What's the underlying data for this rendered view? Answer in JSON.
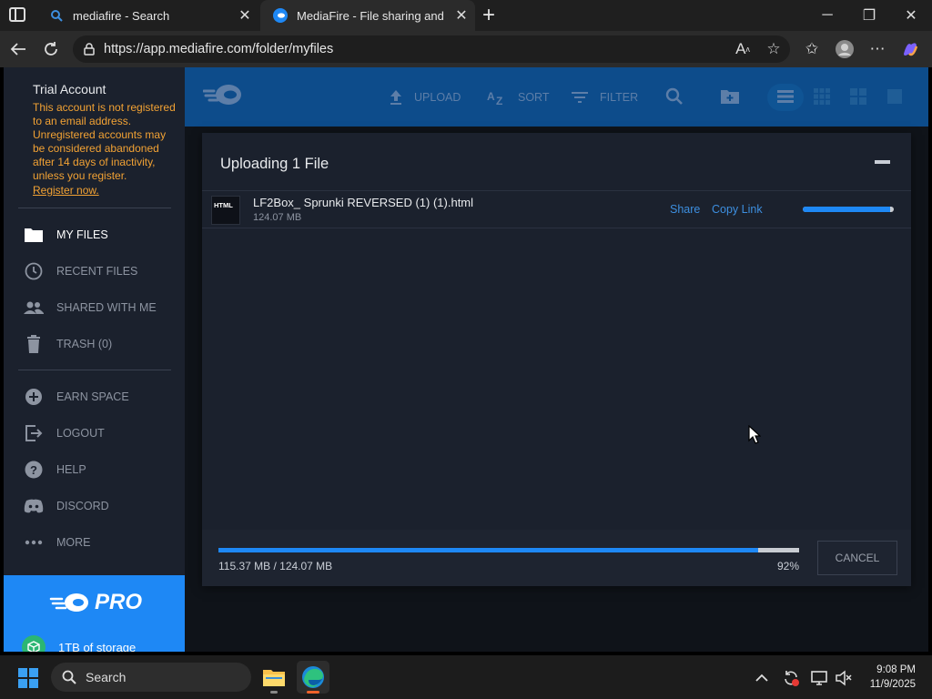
{
  "browser": {
    "tabs": [
      {
        "title": "mediafire - Search"
      },
      {
        "title": "MediaFire - File sharing and stora"
      }
    ],
    "url": "https://app.mediafire.com/folder/myfiles"
  },
  "sidebar": {
    "account_title": "Trial Account",
    "account_message": "This account is not registered to an email address. Unregistered accounts may be considered abandoned after 14 days of inactivity, unless you register.",
    "register_link": "Register now.",
    "nav": [
      {
        "label": "MY FILES",
        "icon": "folder-icon",
        "active": true
      },
      {
        "label": "RECENT FILES",
        "icon": "clock-icon"
      },
      {
        "label": "SHARED WITH ME",
        "icon": "people-icon"
      },
      {
        "label": "TRASH (0)",
        "icon": "trash-icon"
      }
    ],
    "secondary": [
      {
        "label": "EARN SPACE",
        "icon": "plus-circle-icon"
      },
      {
        "label": "LOGOUT",
        "icon": "logout-icon"
      },
      {
        "label": "HELP",
        "icon": "help-icon"
      },
      {
        "label": "DISCORD",
        "icon": "discord-icon"
      },
      {
        "label": "MORE",
        "icon": "more-icon"
      }
    ],
    "pro": {
      "label": "PRO",
      "storage": "1TB of storage"
    }
  },
  "toolbar": {
    "upload": "UPLOAD",
    "sort": "SORT",
    "filter": "FILTER"
  },
  "upload_dialog": {
    "title": "Uploading 1 File",
    "file": {
      "type_label": "HTML",
      "name": "LF2Box_ Sprunki REVERSED (1) (1).html",
      "size": "124.07 MB",
      "share": "Share",
      "copy_link": "Copy Link",
      "progress": 0.96
    },
    "total_text": "115.37 MB / 124.07 MB",
    "percent": "92%",
    "progress": 0.93,
    "cancel": "CANCEL"
  },
  "taskbar": {
    "search": "Search",
    "time": "9:08 PM",
    "date": "11/9/2025"
  },
  "colors": {
    "accent": "#1e88f5",
    "warning": "#f2a234",
    "sidebar": "#1b212d",
    "toolbar": "#0d4c8b"
  }
}
